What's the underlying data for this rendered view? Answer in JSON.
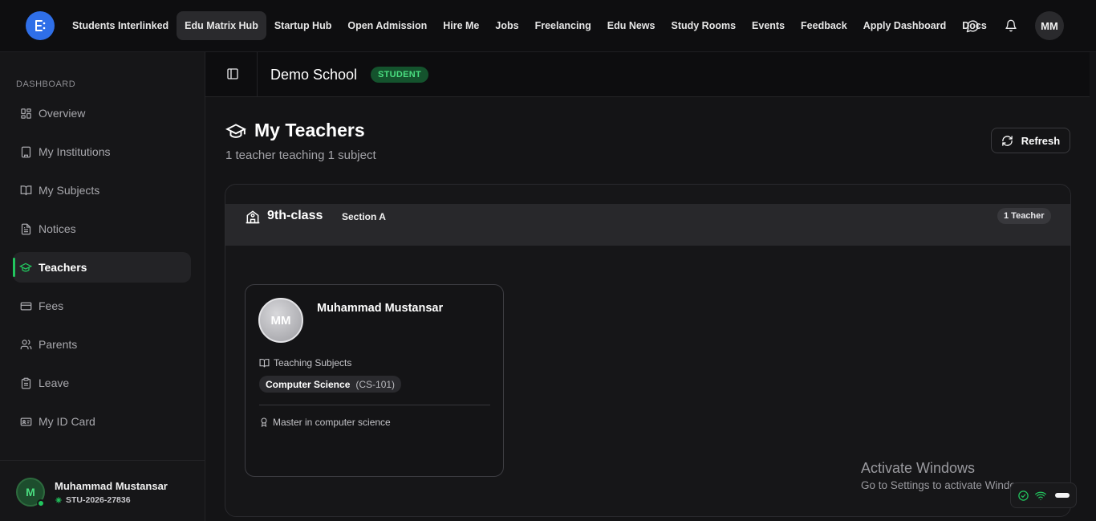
{
  "topnav": {
    "links": [
      {
        "label": "Students Interlinked",
        "active": false
      },
      {
        "label": "Edu Matrix Hub",
        "active": true
      },
      {
        "label": "Startup Hub",
        "active": false
      },
      {
        "label": "Open Admission",
        "active": false
      },
      {
        "label": "Hire Me",
        "active": false
      },
      {
        "label": "Jobs",
        "active": false
      },
      {
        "label": "Freelancing",
        "active": false
      },
      {
        "label": "Edu News",
        "active": false
      },
      {
        "label": "Study Rooms",
        "active": false
      },
      {
        "label": "Events",
        "active": false
      },
      {
        "label": "Feedback",
        "active": false
      },
      {
        "label": "Apply Dashboard",
        "active": false
      },
      {
        "label": "Docs",
        "active": false
      }
    ],
    "avatar_initials": "MM",
    "icons": {
      "logo": "e-logo-icon",
      "messages": "message-circle-icon",
      "notifications": "bell-icon"
    },
    "logo_color": "#2f6fe8"
  },
  "sidebar": {
    "heading": "DASHBOARD",
    "items": [
      {
        "label": "Overview",
        "icon": "layout-grid-icon",
        "active": false
      },
      {
        "label": "My Institutions",
        "icon": "building-icon",
        "active": false
      },
      {
        "label": "My Subjects",
        "icon": "book-open-icon",
        "active": false
      },
      {
        "label": "Notices",
        "icon": "file-text-icon",
        "active": false
      },
      {
        "label": "Teachers",
        "icon": "graduation-cap-icon",
        "active": true
      },
      {
        "label": "Fees",
        "icon": "credit-card-icon",
        "active": false
      },
      {
        "label": "Parents",
        "icon": "users-icon",
        "active": false
      },
      {
        "label": "Leave",
        "icon": "clipboard-icon",
        "active": false
      },
      {
        "label": "My ID Card",
        "icon": "id-card-icon",
        "active": false
      }
    ],
    "footer": {
      "avatar_initial": "M",
      "name": "Muhammad Mustansar",
      "student_id": "STU-2026-27836"
    },
    "accent_color": "#22c55e"
  },
  "header": {
    "school_name": "Demo School",
    "role_badge": "STUDENT"
  },
  "main": {
    "title": "My Teachers",
    "subtitle": "1 teacher teaching 1 subject",
    "refresh_label": "Refresh",
    "classes": [
      {
        "name": "9th-class",
        "section": "Section A",
        "teacher_count": "1 Teacher",
        "teachers": [
          {
            "initials": "MM",
            "name": "Muhammad Mustansar",
            "subjects_label": "Teaching Subjects",
            "subjects": [
              {
                "name": "Computer Science",
                "code": "(CS-101)"
              }
            ],
            "qualification": "Master in computer science"
          }
        ]
      }
    ]
  },
  "os_overlay": {
    "activate_title": "Activate Windows",
    "activate_sub": "Go to Settings to activate Windows."
  }
}
